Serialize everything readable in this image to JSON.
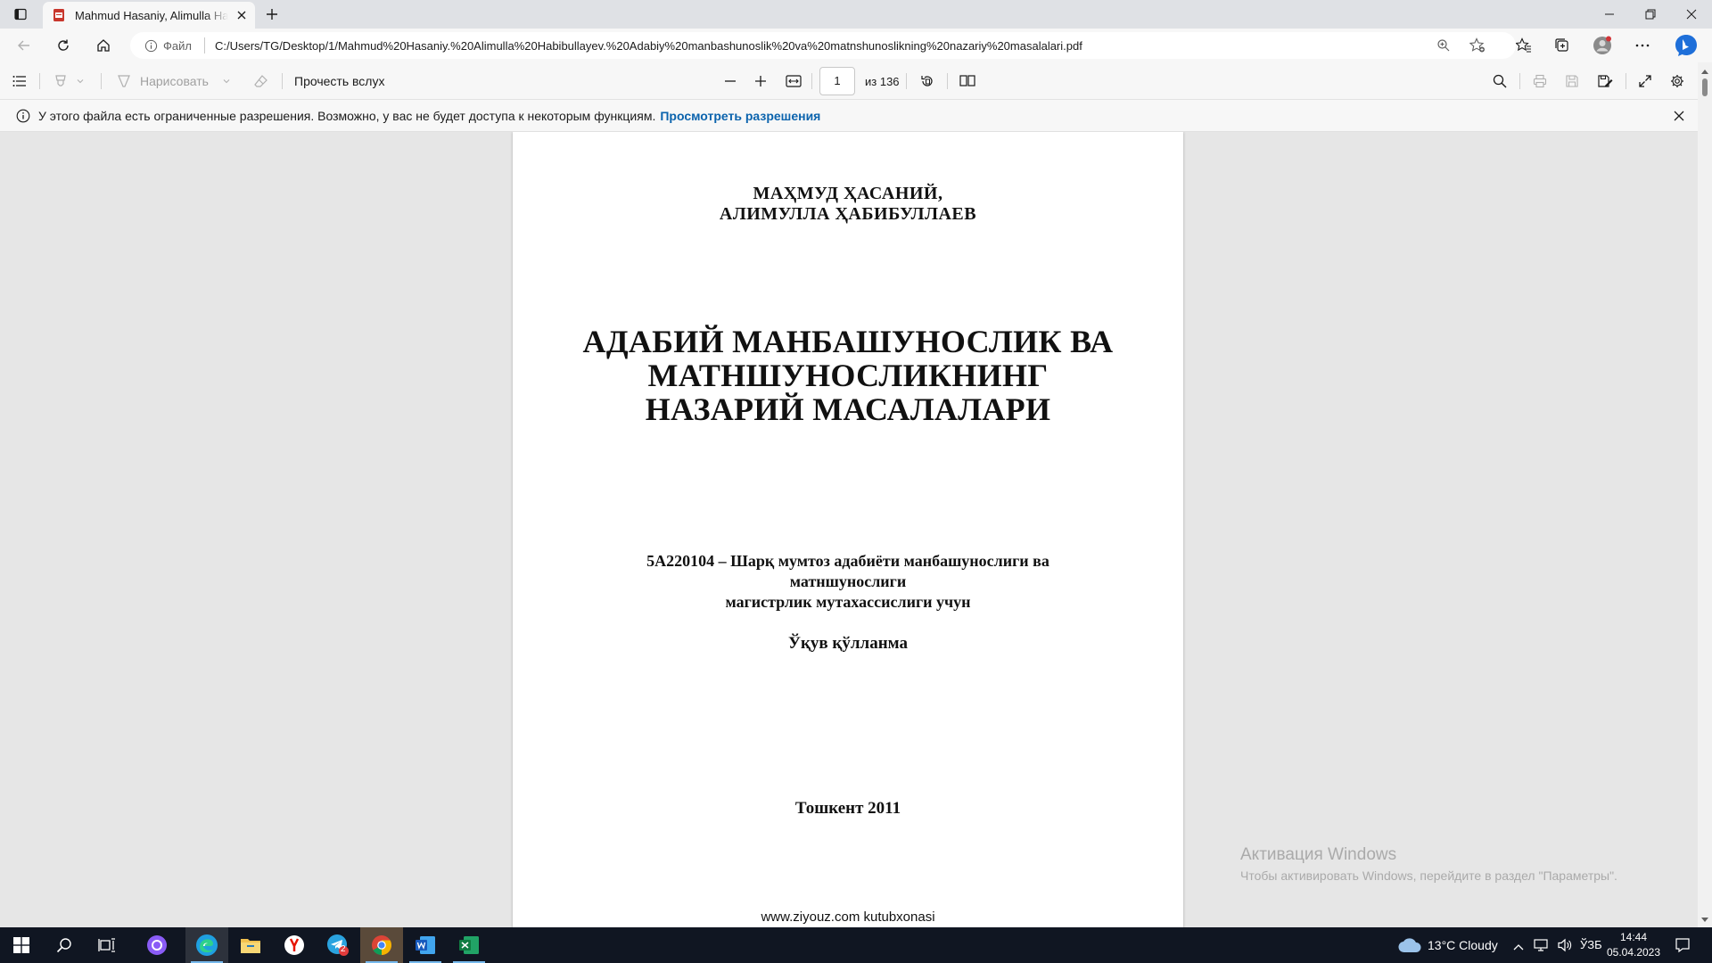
{
  "browser": {
    "tab_title": "Mahmud Hasaniy, Alimulla Habibullayev. Adabiy manbashunoslik va matnshunoslikning nazariy masalalari.pdf",
    "site_label": "Файл",
    "url": "C:/Users/TG/Desktop/1/Mahmud%20Hasaniy.%20Alimulla%20Habibullayev.%20Adabiy%20manbashunoslik%20va%20matnshunoslikning%20nazariy%20masalalari.pdf",
    "accent_color": "#0b63ad"
  },
  "pdf_toolbar": {
    "draw_label": "Нарисовать",
    "read_aloud_label": "Прочесть вслух",
    "current_page": "1",
    "page_count": "из 136"
  },
  "infobar": {
    "message": "У этого файла есть ограниченные разрешения. Возможно, у вас не будет доступа к некоторым функциям.",
    "link": "Просмотреть разрешения"
  },
  "document": {
    "author_line_1": "МАҲМУД ҲАСАНИЙ,",
    "author_line_2": "АЛИМУЛЛА ҲАБИБУЛЛАЕВ",
    "title_line_1": "АДАБИЙ МАНБАШУНОСЛИК ВА",
    "title_line_2": "МАТНШУНОСЛИКНИНГ",
    "title_line_3": "НАЗАРИЙ МАСАЛАЛАРИ",
    "subtitle_line_1": "5А220104 – Шарқ мумтоз адабиёти манбашунослиги ва",
    "subtitle_line_2": "матншунослиги",
    "subtitle_line_3": "магистрлик мутахассислиги учун",
    "doc_type": "Ўқув қўлланма",
    "city_year": "Тошкент 2011",
    "footer_site": "www.ziyouz.com kutubxonasi"
  },
  "watermark": {
    "title": "Активация Windows",
    "subtitle": "Чтобы активировать Windows, перейдите в раздел \"Параметры\"."
  },
  "taskbar": {
    "weather": "13°C  Cloudy",
    "language": "ЎЗБ",
    "time": "14:44",
    "date": "05.04.2023",
    "telegram_badge": "2"
  }
}
